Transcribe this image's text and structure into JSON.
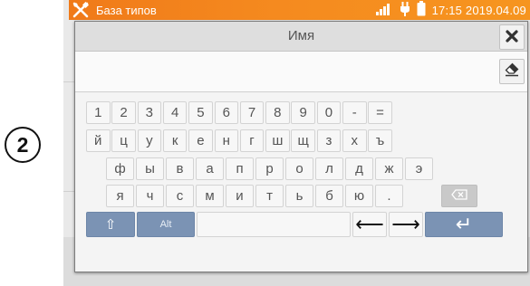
{
  "step_marker": "2",
  "statusbar": {
    "title": "База типов",
    "time": "17:15 2019.04.09",
    "icons": [
      "tool-icon",
      "signal-icon",
      "plug-icon",
      "battery-icon"
    ]
  },
  "dialog": {
    "title": "Имя",
    "close_icon": "close-icon",
    "input_value": "",
    "clear_icon": "eraser-icon"
  },
  "keyboard": {
    "rows": [
      [
        "1",
        "2",
        "3",
        "4",
        "5",
        "6",
        "7",
        "8",
        "9",
        "0",
        "-",
        "="
      ],
      [
        "й",
        "ц",
        "у",
        "к",
        "е",
        "н",
        "г",
        "ш",
        "щ",
        "з",
        "х",
        "ъ"
      ],
      [
        "ф",
        "ы",
        "в",
        "а",
        "п",
        "р",
        "о",
        "л",
        "д",
        "ж",
        "э"
      ],
      [
        "я",
        "ч",
        "с",
        "м",
        "и",
        "т",
        "ь",
        "б",
        "ю",
        "."
      ]
    ],
    "backspace_icon": "backspace-icon",
    "shift_label": "⇧",
    "alt_label": "Alt",
    "space_label": "",
    "left_arrow": "⟵",
    "right_arrow": "⟶",
    "enter_label": "↵"
  },
  "colors": {
    "statusbar": "#f58a1f",
    "special_key": "#7b93b4",
    "backspace_key": "#c9c9c9"
  }
}
